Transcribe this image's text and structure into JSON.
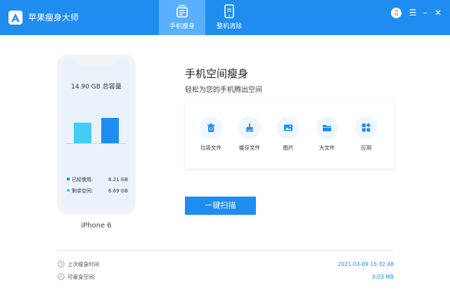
{
  "app": {
    "title": "苹果瘦身大师"
  },
  "tabs": [
    {
      "label": "手机瘦身",
      "icon": "phone-slim-icon",
      "active": true
    },
    {
      "label": "整机清除",
      "icon": "phone-erase-icon",
      "active": false
    }
  ],
  "window_controls": {
    "music": "♫",
    "menu": "☰",
    "minimize": "–",
    "close": "✕"
  },
  "phone": {
    "capacity_label": "14.90 GB 总容量",
    "model": "iPhone 6",
    "used_label": "已经使用:",
    "used_value": "8.21 GB",
    "free_label": "剩余空间:",
    "free_value": "6.69 GB"
  },
  "chart_data": {
    "type": "bar",
    "categories": [
      "剩余空间",
      "已经使用"
    ],
    "values": [
      6.69,
      8.21
    ],
    "ylim": [
      0,
      8.21
    ],
    "colors": [
      "#43cdf5",
      "#1f8df0"
    ]
  },
  "main": {
    "title": "手机空间瘦身",
    "subtitle": "轻松为您的手机腾出空间",
    "categories": [
      {
        "label": "垃圾文件",
        "icon": "trash-icon"
      },
      {
        "label": "缓存文件",
        "icon": "brush-icon"
      },
      {
        "label": "图片",
        "icon": "image-icon"
      },
      {
        "label": "大文件",
        "icon": "folder-icon"
      },
      {
        "label": "应用",
        "icon": "apps-icon"
      }
    ],
    "scan_button": "一键扫描"
  },
  "footer": {
    "last_slim_label": "上次瘦身时间",
    "last_slim_value": "2021-03-09 15:32:48",
    "slimmable_label": "可瘦身空间:",
    "slimmable_value": "9.03 MB"
  },
  "colors": {
    "primary": "#1f8df0",
    "accent_light": "#43cdf5",
    "tab_active": "#5aafff"
  }
}
